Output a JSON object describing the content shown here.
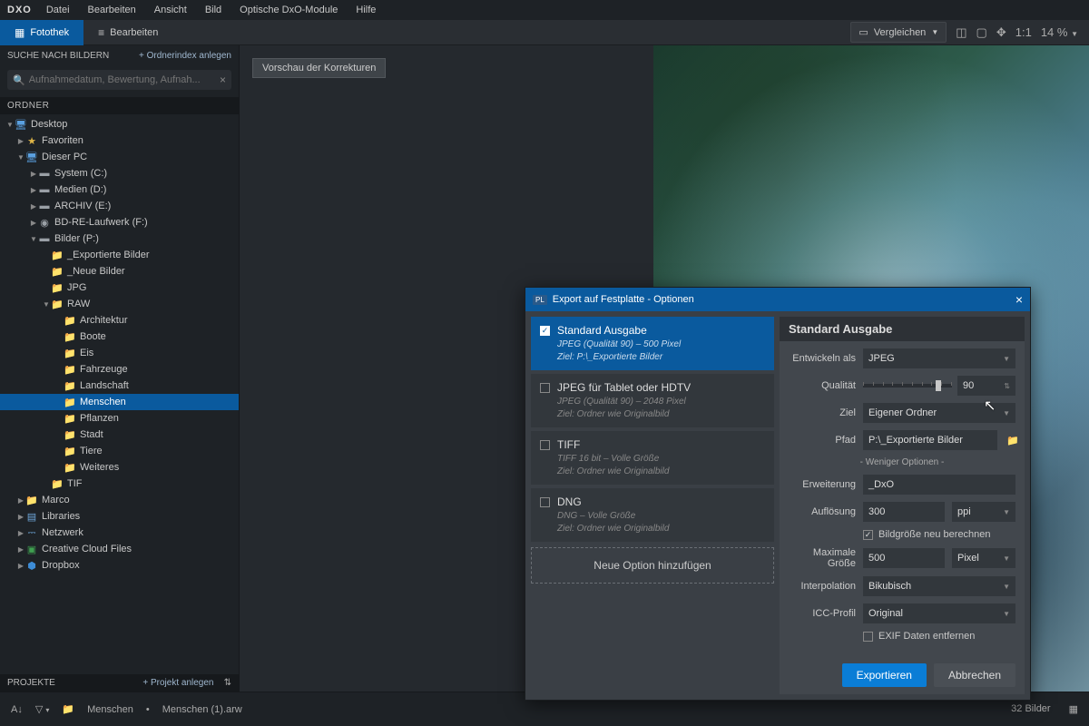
{
  "menubar": {
    "logo": "DXO",
    "items": [
      "Datei",
      "Bearbeiten",
      "Ansicht",
      "Bild",
      "Optische DxO-Module",
      "Hilfe"
    ]
  },
  "modebar": {
    "fotothek": "Fotothek",
    "bearbeiten": "Bearbeiten",
    "compare": "Vergleichen",
    "ratio": "1:1",
    "zoom": "14 %"
  },
  "sidebar": {
    "search_title": "SUCHE NACH BILDERN",
    "add_index": "+ Ordnerindex anlegen",
    "search_placeholder": "Aufnahmedatum, Bewertung, Aufnah...",
    "folders_title": "ORDNER",
    "projects_title": "PROJEKTE",
    "add_project": "+ Projekt anlegen"
  },
  "tree": {
    "desktop": "Desktop",
    "favoriten": "Favoriten",
    "dieser_pc": "Dieser PC",
    "system_c": "System (C:)",
    "medien_d": "Medien (D:)",
    "archiv_e": "ARCHIV (E:)",
    "bdre_f": "BD-RE-Laufwerk (F:)",
    "bilder_p": "Bilder (P:)",
    "exportierte": "_Exportierte Bilder",
    "neue_bilder": "_Neue Bilder",
    "jpg": "JPG",
    "raw": "RAW",
    "architektur": "Architektur",
    "boote": "Boote",
    "eis": "Eis",
    "fahrzeuge": "Fahrzeuge",
    "landschaft": "Landschaft",
    "menschen": "Menschen",
    "pflanzen": "Pflanzen",
    "stadt": "Stadt",
    "tiere": "Tiere",
    "weiteres": "Weiteres",
    "tif": "TIF",
    "marco": "Marco",
    "libraries": "Libraries",
    "netzwerk": "Netzwerk",
    "ccf": "Creative Cloud Files",
    "dropbox": "Dropbox"
  },
  "viewer": {
    "preview_chip": "Vorschau der Korrekturen"
  },
  "dialog": {
    "title": "Export auf Festplatte - Optionen",
    "presets": [
      {
        "name": "Standard Ausgabe",
        "meta1": "JPEG (Qualität 90)  –  500 Pixel",
        "meta2": "Ziel: P:\\_Exportierte Bilder",
        "checked": true
      },
      {
        "name": "JPEG für Tablet oder HDTV",
        "meta1": "JPEG (Qualität 90)  –  2048 Pixel",
        "meta2": "Ziel: Ordner wie Originalbild",
        "checked": false
      },
      {
        "name": "TIFF",
        "meta1": "TIFF 16 bit  –  Volle Größe",
        "meta2": "Ziel: Ordner wie Originalbild",
        "checked": false
      },
      {
        "name": "DNG",
        "meta1": "DNG  –  Volle Größe",
        "meta2": "Ziel: Ordner wie Originalbild",
        "checked": false
      }
    ],
    "add_option": "Neue Option hinzufügen",
    "settings_title": "Standard Ausgabe",
    "labels": {
      "entwickeln": "Entwickeln als",
      "qualitaet": "Qualität",
      "ziel": "Ziel",
      "pfad": "Pfad",
      "less_opts": "- Weniger Optionen -",
      "erweiterung": "Erweiterung",
      "aufloesung": "Auflösung",
      "bildgroesse": "Bildgröße neu berechnen",
      "max_groesse": "Maximale Größe",
      "interpolation": "Interpolation",
      "icc": "ICC-Profil",
      "exif": "EXIF Daten entfernen"
    },
    "values": {
      "entwickeln": "JPEG",
      "qualitaet": "90",
      "ziel": "Eigener Ordner",
      "pfad": "P:\\_Exportierte Bilder",
      "erweiterung": "_DxO",
      "aufloesung": "300",
      "aufloesung_unit": "ppi",
      "max_groesse": "500",
      "max_groesse_unit": "Pixel",
      "interpolation": "Bikubisch",
      "icc": "Original"
    },
    "buttons": {
      "export": "Exportieren",
      "cancel": "Abbrechen"
    }
  },
  "statusbar": {
    "breadcrumb1": "Menschen",
    "breadcrumb2": "Menschen (1).arw",
    "count": "32 Bilder"
  }
}
